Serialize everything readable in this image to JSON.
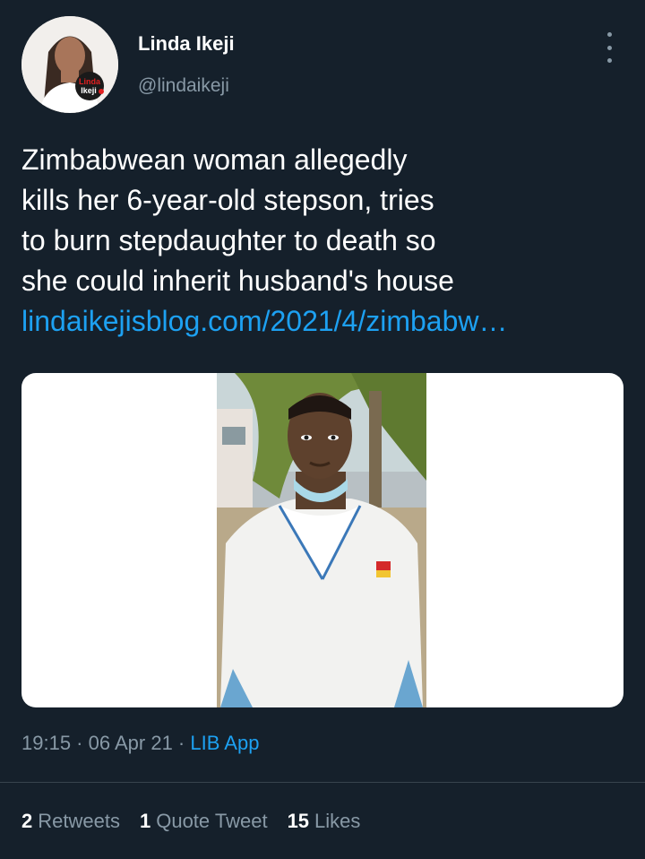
{
  "author": {
    "name": "Linda Ikeji",
    "handle": "@lindaikeji",
    "avatar_logo_text": "Linda Ikeji TV"
  },
  "tweet": {
    "lines": [
      "Zimbabwean woman allegedly",
      "kills her 6-year-old stepson, tries",
      "to burn stepdaughter to death so",
      "she could inherit husband's house"
    ],
    "link": "lindaikejisblog.com/2021/4/zimbabw…"
  },
  "meta": {
    "time": "19:15",
    "separator1": " · ",
    "date": "06 Apr 21",
    "separator2": " · ",
    "source": "LIB App"
  },
  "stats": {
    "retweets_count": "2",
    "retweets_label": "Retweets",
    "quotes_count": "1",
    "quotes_label": "Quote Tweet",
    "likes_count": "15",
    "likes_label": "Likes"
  },
  "colors": {
    "background": "#15202b",
    "accent": "#1da1f2",
    "secondary_text": "#8899a6",
    "divider": "#38444d"
  }
}
